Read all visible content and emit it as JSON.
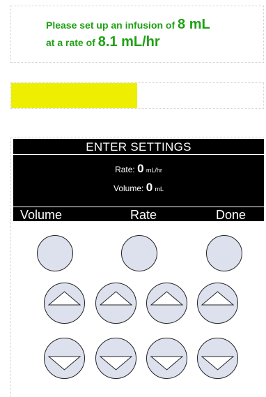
{
  "instruction": {
    "prefix_line1": "Please set up an infusion of ",
    "volume_value": "8 mL",
    "prefix_line2": "at a rate of ",
    "rate_value": "8.1 mL/hr"
  },
  "progress": {
    "fraction": 0.5,
    "color": "#eeee00"
  },
  "screen": {
    "title": "ENTER SETTINGS",
    "rate_label": "Rate: ",
    "rate_value": "0",
    "rate_unit": "mL/hr",
    "volume_label": "Volume: ",
    "volume_value": "0",
    "volume_unit": "mL",
    "softkeys": {
      "volume": "Volume",
      "rate": "Rate",
      "done": "Done"
    }
  },
  "colors": {
    "instruction_text": "#1fa015",
    "button_fill": "#dde1ee",
    "screen_bg": "#000000"
  },
  "icons": {
    "up": "up-arrow-icon",
    "down": "down-arrow-icon"
  }
}
